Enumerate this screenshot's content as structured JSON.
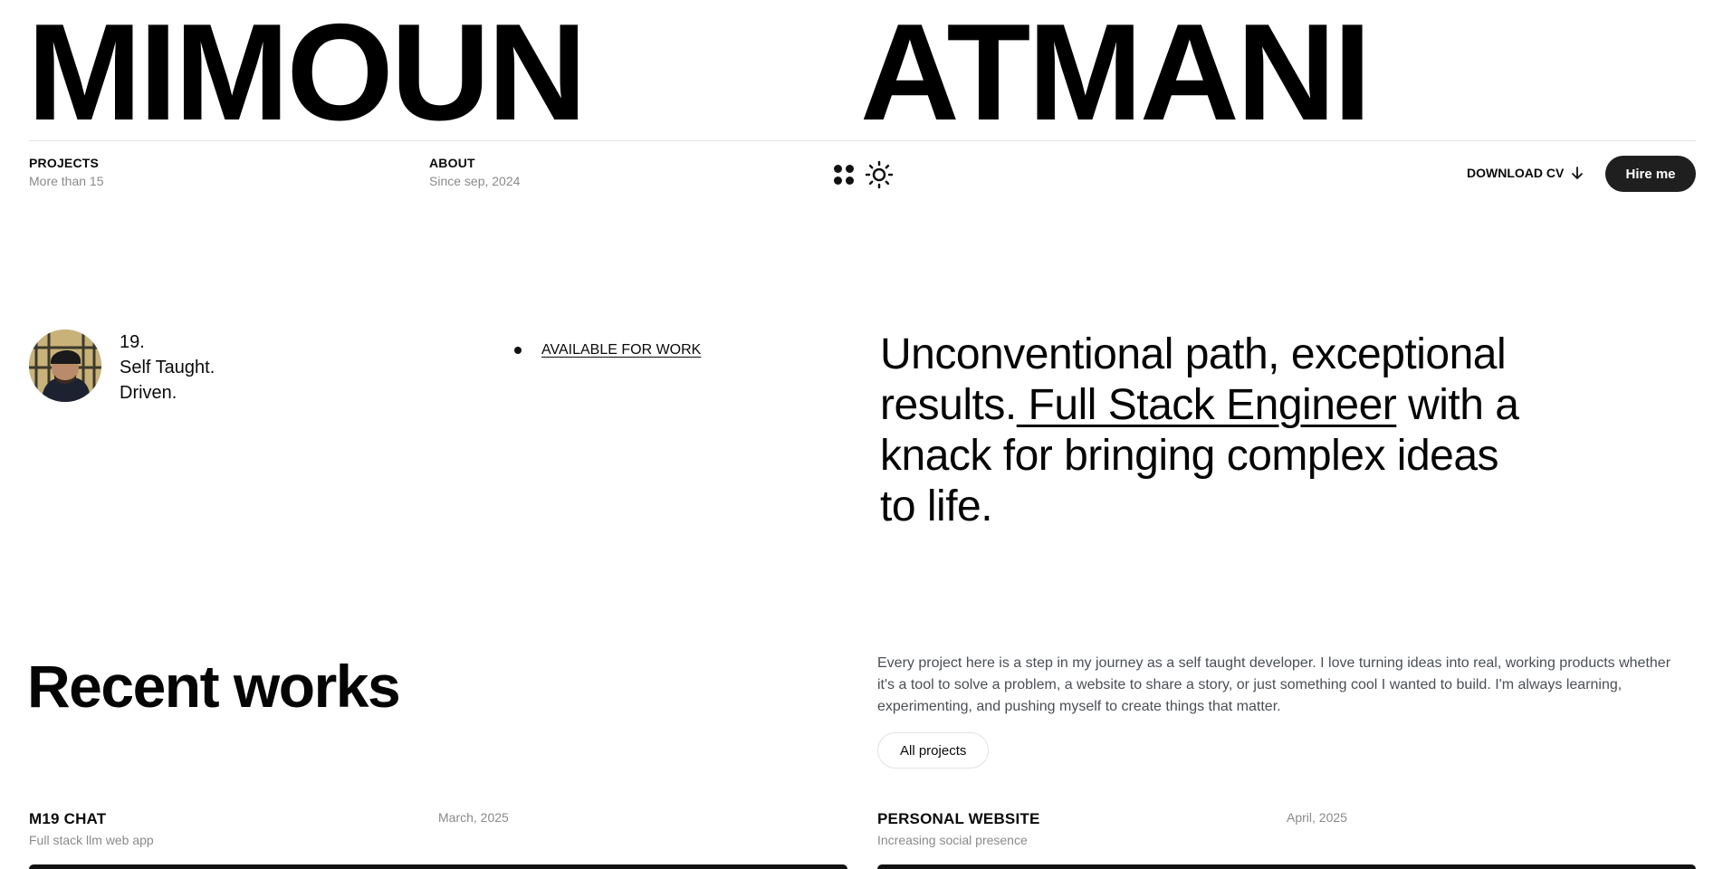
{
  "hero": {
    "first_name": "MIMOUN",
    "last_name": "ATMANI"
  },
  "nav": {
    "projects_label": "PROJECTS",
    "projects_sub": "More than 15",
    "about_label": "ABOUT",
    "about_sub": "Since sep, 2024",
    "download_cv_label": "DOWNLOAD CV",
    "hire_label": "Hire me"
  },
  "profile": {
    "age": "19.",
    "trait1": "Self Taught.",
    "trait2": "Driven.",
    "availability": "AVAILABLE FOR WORK"
  },
  "tagline": {
    "part1": "Unconventional path, exceptional results.",
    "highlight": " Full Stack Engineer",
    "part2": " with a knack for bringing complex ideas to life."
  },
  "recent": {
    "title": "Recent works",
    "intro": "Every project here is a step in my journey as a self taught developer. I love turning ideas into real, working products whether it's a tool to solve a problem, a website to share a story, or just something cool I wanted to build. I'm always learning, experimenting, and pushing myself to create things that matter.",
    "all_projects_label": "All projects",
    "projects": [
      {
        "title": "M19 CHAT",
        "subtitle": "Full stack llm web app",
        "date": "March, 2025"
      },
      {
        "title": "PERSONAL WEBSITE",
        "subtitle": "Increasing social presence",
        "date": "April, 2025"
      }
    ]
  },
  "colors": {
    "text": "#0a0a0a",
    "muted": "#8a8a8a",
    "button_dark": "#1f1f1f",
    "background": "#ffffff"
  },
  "icons": [
    "dots-grid-icon",
    "sun-icon",
    "arrow-down-icon"
  ]
}
